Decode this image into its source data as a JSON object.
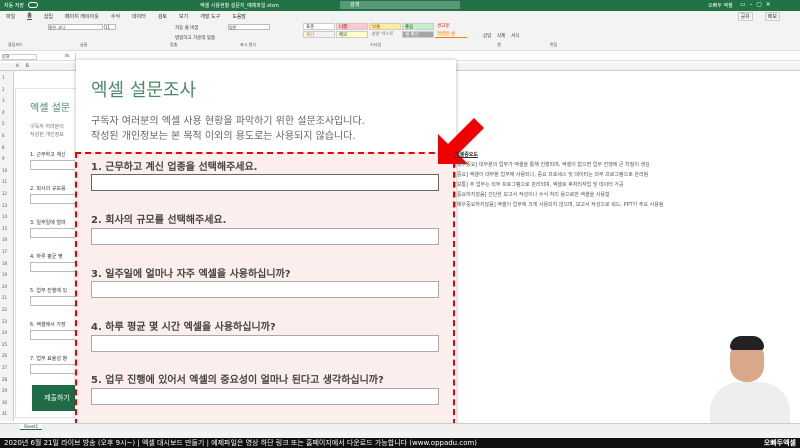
{
  "titlebar": {
    "autosave": "자동 저장",
    "filename": "엑셀 사용현황 설문지_예제파일.xlsm",
    "search": "검색",
    "user": "오빠두 엑셀"
  },
  "tabs": [
    "파일",
    "홈",
    "삽입",
    "페이지 레이아웃",
    "수식",
    "데이터",
    "검토",
    "보기",
    "개발 도구",
    "도움말"
  ],
  "ribbon": {
    "groups": [
      "클립보드",
      "글꼴",
      "맞춤",
      "표시 형식",
      "스타일",
      "셀",
      "편집"
    ],
    "font": "맑은 고딕",
    "size": "11",
    "number_format": "일반",
    "styles": [
      "표준",
      "나쁨",
      "보통",
      "좋음",
      "경고문",
      "계산",
      "메모",
      "설명 텍스트",
      "셀 확인",
      "연결된 셀"
    ],
    "cells": [
      "삽입",
      "삭제",
      "서식"
    ],
    "share": "공유",
    "memo": "메모",
    "wrap": "자동 줄 바꿈",
    "merge": "병합하고 가운데 맞춤"
  },
  "formula": {
    "namebox": "C9",
    "fx": "fx"
  },
  "columns": [
    "A",
    "B"
  ],
  "rows": [
    "1",
    "2",
    "3",
    "4",
    "5",
    "6",
    "8",
    "9",
    "10",
    "11",
    "12",
    "13",
    "14",
    "15",
    "16",
    "17",
    "18",
    "19",
    "20",
    "21",
    "22",
    "23",
    "24",
    "25",
    "26",
    "27",
    "28",
    "29",
    "30",
    "31"
  ],
  "leftform": {
    "title": "엑셀 설문",
    "intro1": "구독자 여러분의",
    "intro2": "작성된 개인정보",
    "questions": [
      "1. 근무하고 계신",
      "2. 회사의 규모를",
      "3. 일주일에 얼마",
      "4. 하루 평균 몇",
      "5. 업무 진행에 있",
      "6. 엑셀에서 가장",
      "7. 업무 효율성 향"
    ],
    "submit": "제출하기"
  },
  "panel": {
    "title": "엑셀 설문조사",
    "sub1": "구독자 여러분의 엑셀 사용 현황을 파악하기 위한 설문조사입니다.",
    "sub2": "작성된 개인정보는 본 목적 이외의 용도로는 사용되지 않습니다.",
    "questions": [
      "1. 근무하고 계신 업종을 선택해주세요.",
      "2. 회사의 규모를 선택해주세요.",
      "3. 일주일에 얼마나 자주 엑셀을 사용하십니까?",
      "4. 하루 평균 몇 시간 엑셀을 사용하십니까?",
      "5. 업무 진행에 있어서 엑셀의 중요성이 얼마나 된다고 생각하십니까?"
    ]
  },
  "notes": {
    "heading": "엑셀중요도",
    "lines": [
      "[매우중요] 대부분의 업무가 엑셀을 통해 진행되며, 엑셀이 없으면 업무 진행에 큰 차질이 생김",
      "[중요] 엑셀이 대부분 업무에 사용되나, 중요 프로세스 및 데이터는 외부 프로그램으로 관리됨",
      "[보통] 주 업무는 외부 프로그램으로 관리되며, 엑셀로 후처리작업 및 데이터 가공",
      "[중요하지않음] 간단한 보고서 작성이나 수식 처리 용으로만 엑셀을 사용함",
      "[매우중요하지않음] 엑셀이 업무에 크게 사용되지 않으며, 보고서 작성으로 워드, PPT가 주요 사용됨"
    ]
  },
  "sheet_tab": "Sheet1",
  "banner": "2020년 6월 21일 라이브 방송 (오후 9시~) | 엑셀 대시보드 만들기 | 예제파일은 영상 하단 링크 또는 홈페이지에서 다운로드 가능합니다 (www.oppadu.com)",
  "logo": "오빠두엑셀",
  "colors": {
    "excel_green": "#217346",
    "highlight_red": "#e00000"
  }
}
